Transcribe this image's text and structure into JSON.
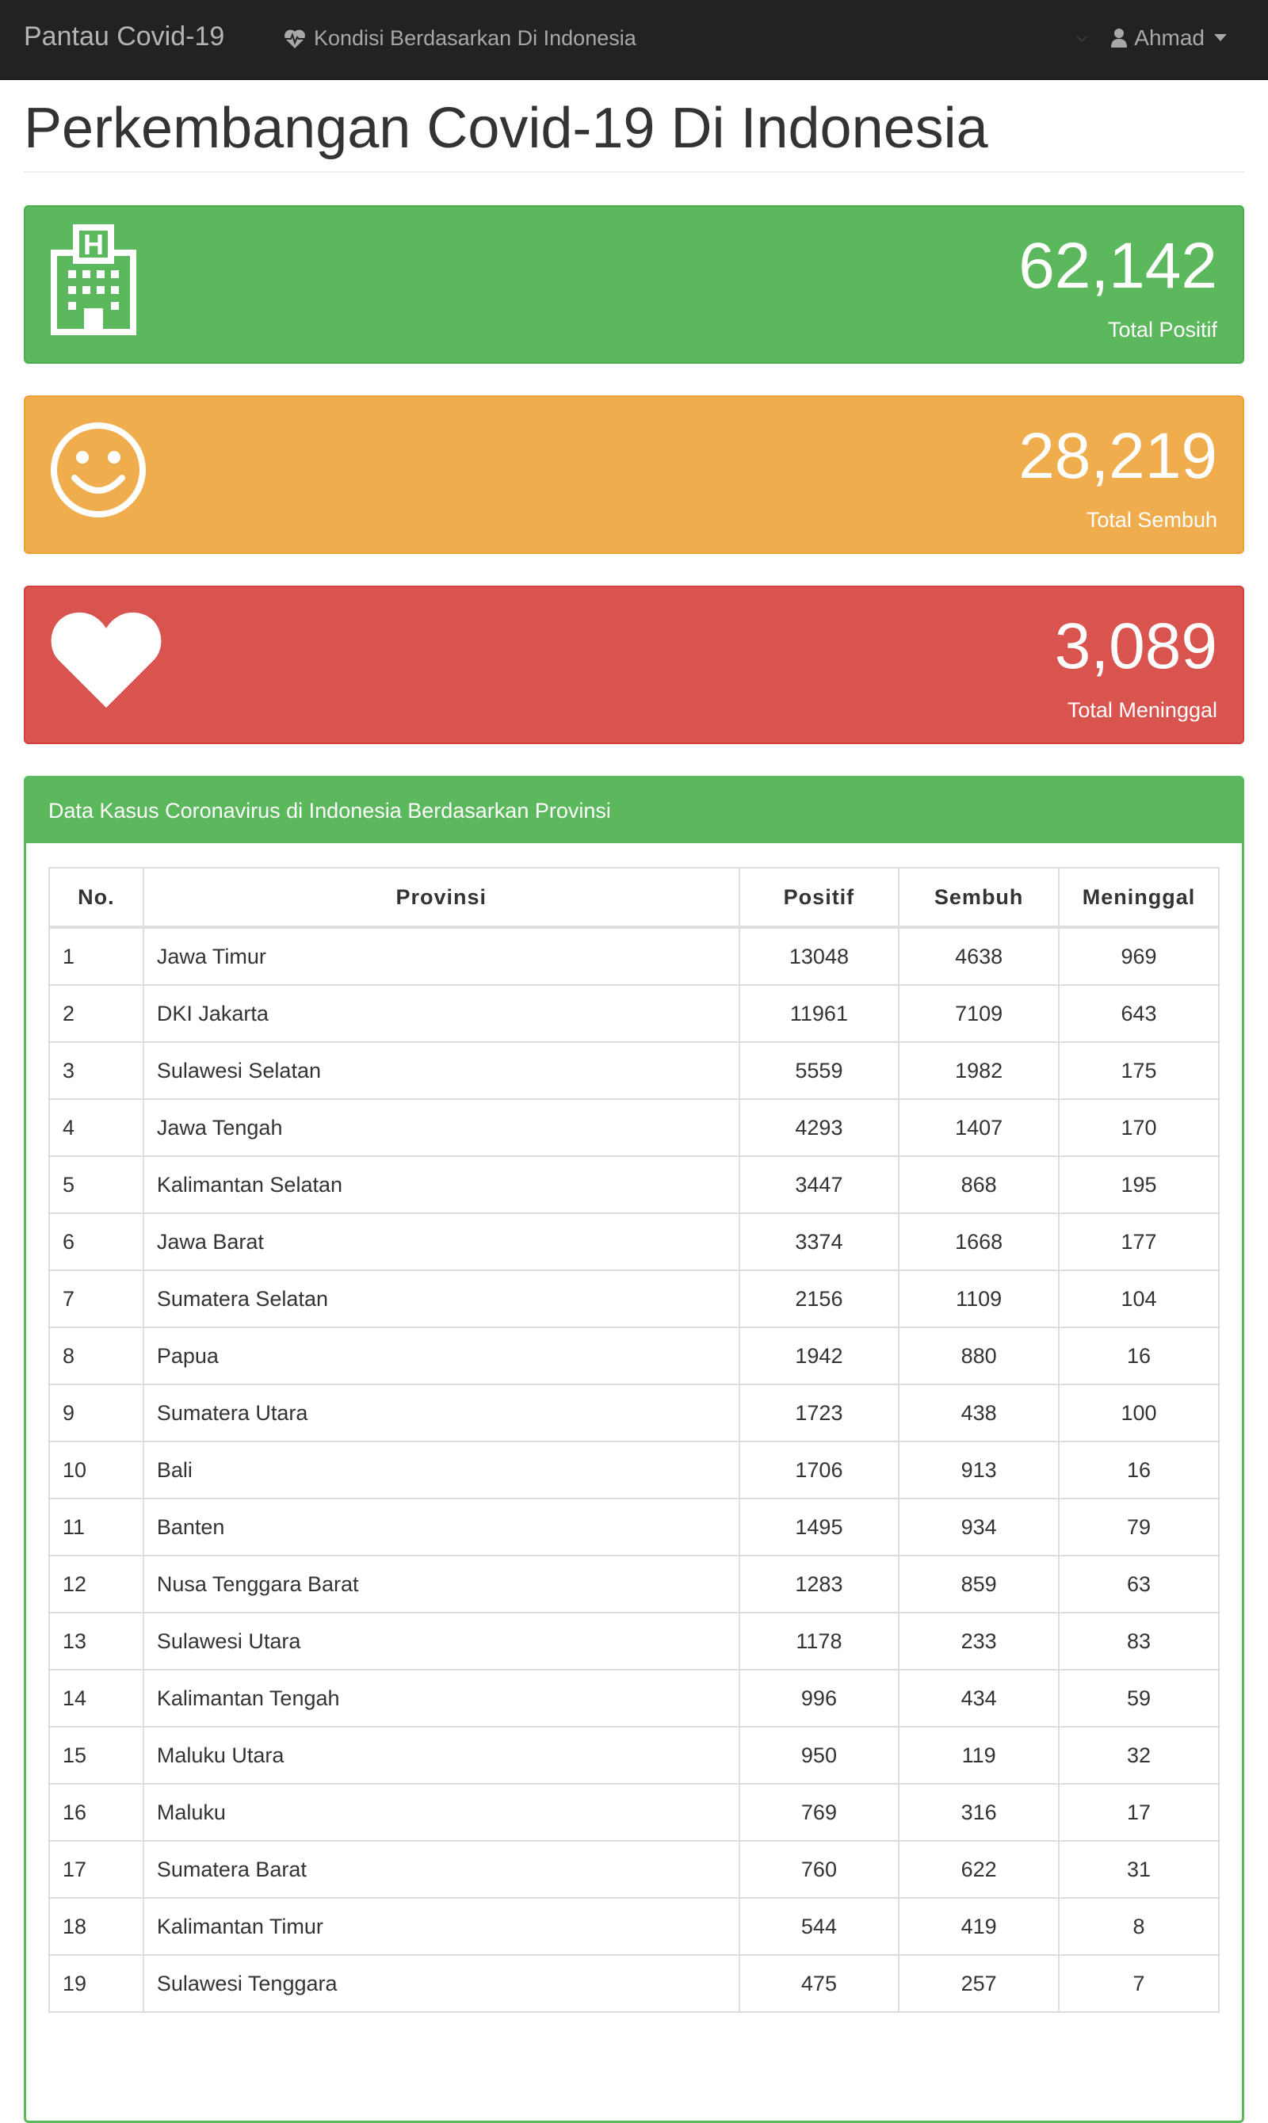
{
  "navbar": {
    "brand": "Pantau Covid-19",
    "link_label": "Kondisi Berdasarkan Di Indonesia",
    "link_icon": "heartbeat-icon",
    "user_label": "Ahmad",
    "user_icon": "user-icon"
  },
  "page": {
    "title": "Perkembangan Covid-19 Di Indonesia"
  },
  "stats": {
    "positif": {
      "value": "62,142",
      "label": "Total Positif",
      "icon": "hospital-icon",
      "color": "#5cb85c"
    },
    "sembuh": {
      "value": "28,219",
      "label": "Total Sembuh",
      "icon": "smile-icon",
      "color": "#f0ad4e"
    },
    "meninggal": {
      "value": "3,089",
      "label": "Total Meninggal",
      "icon": "heart-icon",
      "color": "#d9534f"
    }
  },
  "table_panel": {
    "heading": "Data Kasus Coronavirus di Indonesia Berdasarkan Provinsi",
    "columns": [
      "No.",
      "Provinsi",
      "Positif",
      "Sembuh",
      "Meninggal"
    ],
    "rows": [
      [
        "1",
        "Jawa Timur",
        "13048",
        "4638",
        "969"
      ],
      [
        "2",
        "DKI Jakarta",
        "11961",
        "7109",
        "643"
      ],
      [
        "3",
        "Sulawesi Selatan",
        "5559",
        "1982",
        "175"
      ],
      [
        "4",
        "Jawa Tengah",
        "4293",
        "1407",
        "170"
      ],
      [
        "5",
        "Kalimantan Selatan",
        "3447",
        "868",
        "195"
      ],
      [
        "6",
        "Jawa Barat",
        "3374",
        "1668",
        "177"
      ],
      [
        "7",
        "Sumatera Selatan",
        "2156",
        "1109",
        "104"
      ],
      [
        "8",
        "Papua",
        "1942",
        "880",
        "16"
      ],
      [
        "9",
        "Sumatera Utara",
        "1723",
        "438",
        "100"
      ],
      [
        "10",
        "Bali",
        "1706",
        "913",
        "16"
      ],
      [
        "11",
        "Banten",
        "1495",
        "934",
        "79"
      ],
      [
        "12",
        "Nusa Tenggara Barat",
        "1283",
        "859",
        "63"
      ],
      [
        "13",
        "Sulawesi Utara",
        "1178",
        "233",
        "83"
      ],
      [
        "14",
        "Kalimantan Tengah",
        "996",
        "434",
        "59"
      ],
      [
        "15",
        "Maluku Utara",
        "950",
        "119",
        "32"
      ],
      [
        "16",
        "Maluku",
        "769",
        "316",
        "17"
      ],
      [
        "17",
        "Sumatera Barat",
        "760",
        "622",
        "31"
      ],
      [
        "18",
        "Kalimantan Timur",
        "544",
        "419",
        "8"
      ],
      [
        "19",
        "Sulawesi Tenggara",
        "475",
        "257",
        "7"
      ]
    ]
  }
}
